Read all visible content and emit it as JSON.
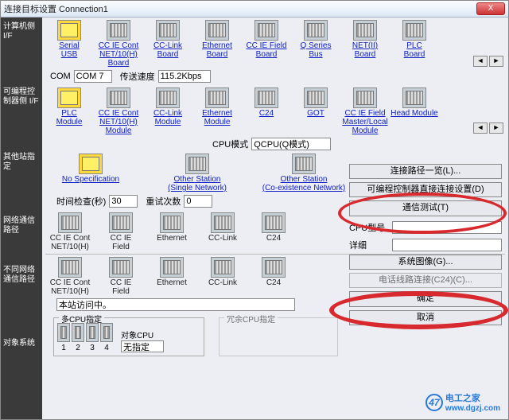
{
  "title": "连接目标设置 Connection1",
  "close": "X",
  "side": [
    "计算机侧I/F",
    "可编程控制器侧 I/F",
    "其他站指定",
    "网络通信路径",
    "不同网络通信路径",
    "对象系统"
  ],
  "row1": [
    {
      "l": "Serial\nUSB",
      "y": true
    },
    {
      "l": "CC IE Cont\nNET/10(H)\nBoard"
    },
    {
      "l": "CC-Link\nBoard"
    },
    {
      "l": "Ethernet\nBoard"
    },
    {
      "l": "CC IE Field\nBoard"
    },
    {
      "l": "Q Series\nBus"
    },
    {
      "l": "NET(II)\nBoard"
    },
    {
      "l": "PLC\nBoard"
    }
  ],
  "com": {
    "lab": "COM",
    "val": "COM 7",
    "spd_lab": "传送速度",
    "spd": "115.2Kbps"
  },
  "row2": [
    {
      "l": "PLC\nModule",
      "y": true
    },
    {
      "l": "CC IE Cont\nNET/10(H)\nModule"
    },
    {
      "l": "CC-Link\nModule"
    },
    {
      "l": "Ethernet\nModule"
    },
    {
      "l": "C24"
    },
    {
      "l": "GOT"
    },
    {
      "l": "CC IE Field\nMaster/Local\nModule"
    },
    {
      "l": "Head Module"
    }
  ],
  "cpumode": {
    "lab": "CPU模式",
    "val": "QCPU(Q模式)"
  },
  "row3": [
    {
      "l": "No Specification",
      "y": true
    },
    {
      "l": "Other Station\n(Single Network)"
    },
    {
      "l": "Other Station\n(Co-existence Network)"
    }
  ],
  "time": {
    "lab": "时间检查(秒)",
    "val": "30",
    "retry_lab": "重试次数",
    "retry": "0"
  },
  "row4": [
    "CC IE Cont\nNET/10(H)",
    "CC IE\nField",
    "Ethernet",
    "CC-Link",
    "C24"
  ],
  "row5": [
    "CC IE Cont\nNET/10(H)",
    "CC IE\nField",
    "Ethernet",
    "CC-Link",
    "C24"
  ],
  "visit": "本站访问中。",
  "multicpu": {
    "legend": "多CPU指定",
    "nums": [
      "1",
      "2",
      "3",
      "4"
    ],
    "tgt_lab": "对象CPU",
    "tgt_val": "无指定"
  },
  "redun": "冗余CPU指定",
  "rb": {
    "list": "连接路径一览(L)...",
    "direct": "可编程控制器直接连接设置(D)",
    "test": "通信测试(T)",
    "cputype": "CPU型号",
    "detail": "详细",
    "sys": "系统图像(G)...",
    "tel": "电话线路连接(C24)(C)...",
    "ok": "确定",
    "cancel": "取消"
  },
  "watermark": {
    "site": "电工之家",
    "url": "www.dgzj.com",
    "logo": "47"
  }
}
